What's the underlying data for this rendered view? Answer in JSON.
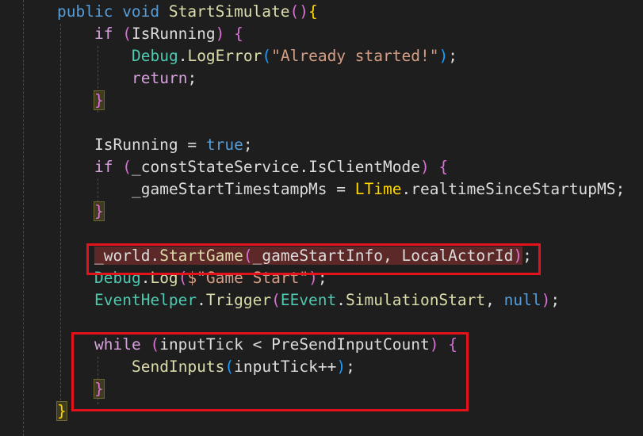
{
  "colors": {
    "background": "#1e1e1e",
    "keyword": "#569cd6",
    "control": "#d8a0df",
    "method": "#dcdcaa",
    "type": "#4ec9b0",
    "string": "#d69d85",
    "field": "#dcdcdc",
    "gold": "#ffd700",
    "purple": "#da70d6",
    "blue_bracket": "#179fff",
    "annotation_box": "#e4121a"
  },
  "code_lines": [
    {
      "indent": 1,
      "tokens": [
        {
          "text": "public ",
          "c": "#569cd6"
        },
        {
          "text": "void ",
          "c": "#569cd6"
        },
        {
          "text": "StartSimulate",
          "c": "#dcdcaa"
        },
        {
          "text": "()",
          "c": "#da70d6"
        },
        {
          "text": "{",
          "c": "#ffd700"
        }
      ]
    },
    {
      "indent": 2,
      "tokens": [
        {
          "text": "if ",
          "c": "#d8a0df"
        },
        {
          "text": "(",
          "c": "#da70d6"
        },
        {
          "text": "IsRunning",
          "c": "#dcdcdc"
        },
        {
          "text": ") ",
          "c": "#da70d6"
        },
        {
          "text": "{",
          "c": "#da70d6"
        }
      ]
    },
    {
      "indent": 3,
      "tokens": [
        {
          "text": "Debug",
          "c": "#4ec9b0"
        },
        {
          "text": ".",
          "c": "#dcdcdc"
        },
        {
          "text": "LogError",
          "c": "#dcdcaa"
        },
        {
          "text": "(",
          "c": "#179fff"
        },
        {
          "text": "\"Already started!\"",
          "c": "#d69d85"
        },
        {
          "text": ")",
          "c": "#179fff"
        },
        {
          "text": ";",
          "c": "#dcdcdc"
        }
      ]
    },
    {
      "indent": 3,
      "tokens": [
        {
          "text": "return",
          "c": "#d8a0df"
        },
        {
          "text": ";",
          "c": "#dcdcdc"
        }
      ]
    },
    {
      "indent": 2,
      "tokens": [
        {
          "text": "}",
          "c": "#da70d6",
          "hl": "brace"
        }
      ]
    },
    {
      "indent": 0,
      "tokens": []
    },
    {
      "indent": 2,
      "tokens": [
        {
          "text": "IsRunning",
          "c": "#dcdcdc"
        },
        {
          "text": " = ",
          "c": "#dcdcdc"
        },
        {
          "text": "true",
          "c": "#569cd6"
        },
        {
          "text": ";",
          "c": "#dcdcdc"
        }
      ]
    },
    {
      "indent": 2,
      "tokens": [
        {
          "text": "if ",
          "c": "#d8a0df"
        },
        {
          "text": "(",
          "c": "#da70d6"
        },
        {
          "text": "_constStateService",
          "c": "#dcdcdc"
        },
        {
          "text": ".",
          "c": "#dcdcdc"
        },
        {
          "text": "IsClientMode",
          "c": "#dcdcdc"
        },
        {
          "text": ") ",
          "c": "#da70d6"
        },
        {
          "text": "{",
          "c": "#da70d6"
        }
      ]
    },
    {
      "indent": 3,
      "tokens": [
        {
          "text": "_gameStartTimestampMs",
          "c": "#dcdcdc"
        },
        {
          "text": " = ",
          "c": "#dcdcdc"
        },
        {
          "text": "LTime",
          "c": "#ffd700"
        },
        {
          "text": ".",
          "c": "#dcdcdc"
        },
        {
          "text": "realtimeSinceStartupMS",
          "c": "#dcdcdc"
        },
        {
          "text": ";",
          "c": "#dcdcdc"
        }
      ]
    },
    {
      "indent": 2,
      "tokens": [
        {
          "text": "}",
          "c": "#da70d6",
          "hl": "brace"
        }
      ]
    },
    {
      "indent": 0,
      "tokens": []
    },
    {
      "indent": 2,
      "tokens": [
        {
          "text": "_world",
          "c": "#dcdcdc",
          "hl": "match"
        },
        {
          "text": ".",
          "c": "#dcdcdc",
          "hl": "match"
        },
        {
          "text": "StartGame",
          "c": "#dcdcaa",
          "hl": "match"
        },
        {
          "text": "(",
          "c": "#da70d6",
          "hl": "match"
        },
        {
          "text": "_gameStartInfo",
          "c": "#dcdcdc",
          "hl": "match"
        },
        {
          "text": ", ",
          "c": "#dcdcdc",
          "hl": "match"
        },
        {
          "text": "LocalActorId",
          "c": "#dcdcdc",
          "hl": "match"
        },
        {
          "text": ")",
          "c": "#da70d6",
          "hl": "match"
        },
        {
          "text": ";",
          "c": "#dcdcdc"
        }
      ]
    },
    {
      "indent": 2,
      "tokens": [
        {
          "text": "Debug",
          "c": "#4ec9b0"
        },
        {
          "text": ".",
          "c": "#dcdcdc"
        },
        {
          "text": "Log",
          "c": "#dcdcaa"
        },
        {
          "text": "(",
          "c": "#da70d6"
        },
        {
          "text": "$\"Game Start\"",
          "c": "#d69d85"
        },
        {
          "text": ")",
          "c": "#da70d6"
        },
        {
          "text": ";",
          "c": "#dcdcdc"
        }
      ]
    },
    {
      "indent": 2,
      "tokens": [
        {
          "text": "EventHelper",
          "c": "#4ec9b0"
        },
        {
          "text": ".",
          "c": "#dcdcdc"
        },
        {
          "text": "Trigger",
          "c": "#dcdcaa"
        },
        {
          "text": "(",
          "c": "#da70d6"
        },
        {
          "text": "EEvent",
          "c": "#4ec9b0"
        },
        {
          "text": ".",
          "c": "#dcdcdc"
        },
        {
          "text": "SimulationStart",
          "c": "#dcdcaa"
        },
        {
          "text": ", ",
          "c": "#dcdcdc"
        },
        {
          "text": "null",
          "c": "#569cd6"
        },
        {
          "text": ")",
          "c": "#da70d6"
        },
        {
          "text": ";",
          "c": "#dcdcdc"
        }
      ]
    },
    {
      "indent": 0,
      "tokens": []
    },
    {
      "indent": 2,
      "tokens": [
        {
          "text": "while ",
          "c": "#d8a0df"
        },
        {
          "text": "(",
          "c": "#da70d6"
        },
        {
          "text": "inputTick",
          "c": "#dcdcdc"
        },
        {
          "text": " < ",
          "c": "#dcdcdc"
        },
        {
          "text": "PreSendInputCount",
          "c": "#dcdcdc"
        },
        {
          "text": ") ",
          "c": "#da70d6"
        },
        {
          "text": "{",
          "c": "#da70d6"
        }
      ]
    },
    {
      "indent": 3,
      "tokens": [
        {
          "text": "SendInputs",
          "c": "#dcdcaa"
        },
        {
          "text": "(",
          "c": "#179fff"
        },
        {
          "text": "inputTick",
          "c": "#dcdcdc"
        },
        {
          "text": "++",
          "c": "#dcdcdc"
        },
        {
          "text": ")",
          "c": "#179fff"
        },
        {
          "text": ";",
          "c": "#dcdcdc"
        }
      ]
    },
    {
      "indent": 2,
      "tokens": [
        {
          "text": "}",
          "c": "#da70d6",
          "hl": "brace"
        }
      ]
    },
    {
      "indent": 1,
      "tokens": [
        {
          "text": "}",
          "c": "#ffd700",
          "hl": "brace"
        }
      ]
    }
  ]
}
